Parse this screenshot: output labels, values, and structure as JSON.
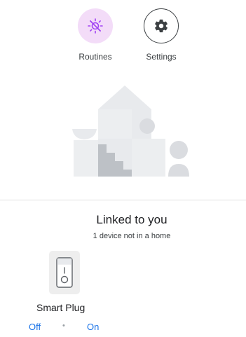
{
  "shortcuts": {
    "routines": {
      "label": "Routines",
      "icon": "routines-sun-icon",
      "accent": "#f3dcf8",
      "icon_color": "#a142f4"
    },
    "settings": {
      "label": "Settings",
      "icon": "gear-icon"
    }
  },
  "linked_section": {
    "title": "Linked to you",
    "subtitle": "1 device not in a home"
  },
  "devices": [
    {
      "name": "Smart Plug",
      "icon": "smart-plug-icon",
      "off_label": "Off",
      "separator": "•",
      "on_label": "On"
    }
  ],
  "colors": {
    "link": "#1a73e8",
    "illustration_light": "#e8eaed",
    "illustration_mid": "#dadce0",
    "illustration_dark": "#bdc1c6"
  }
}
